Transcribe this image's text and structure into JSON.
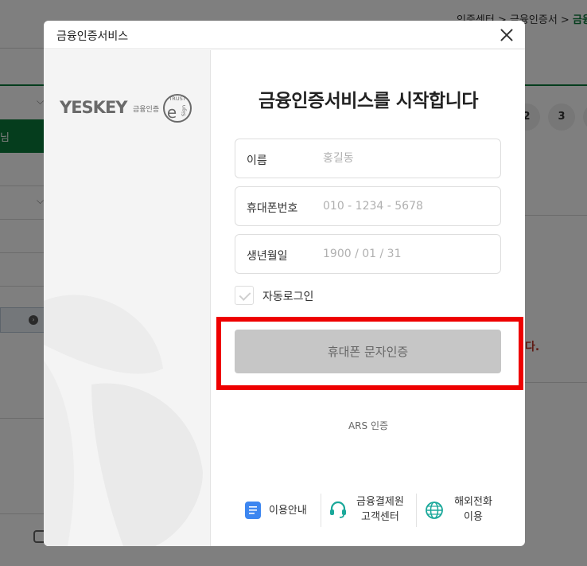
{
  "background": {
    "breadcrumb": {
      "part1": "인증센터 > 금융인증서 > ",
      "current": "금융"
    },
    "green_tab_label": "님",
    "pages": [
      "2",
      "3"
    ],
    "red_text": "다."
  },
  "modal": {
    "title": "금융인증서비스",
    "logo": {
      "text": "YESKEY",
      "sub": "금융인증",
      "badge_top": "TRUST",
      "badge_mid": "e",
      "badge_side": "Sign"
    },
    "heading": "금융인증서비스를 시작합니다",
    "fields": [
      {
        "label": "이름",
        "placeholder": "홍길동"
      },
      {
        "label": "휴대폰번호",
        "placeholder": "010 - 1234 - 5678"
      },
      {
        "label": "생년월일",
        "placeholder": "1900 / 01 / 31"
      }
    ],
    "auto_login_label": "자동로그인",
    "sms_button": "휴대폰 문자인증",
    "ars_link": "ARS 인증",
    "footer": {
      "guide": "이용안내",
      "support_line1": "금융결제원",
      "support_line2": "고객센터",
      "overseas_line1": "해외전화",
      "overseas_line2": "이용"
    }
  },
  "colors": {
    "accent_green": "#0b7a3b",
    "highlight_red": "#ee0000",
    "button_gray": "#c6c6c6",
    "guide_icon_blue": "#3d86f0",
    "support_icon_teal": "#1aa89a"
  },
  "icons": [
    "close-icon",
    "checkmark-icon",
    "document-icon",
    "headset-icon",
    "globe-icon",
    "chat-icon"
  ]
}
